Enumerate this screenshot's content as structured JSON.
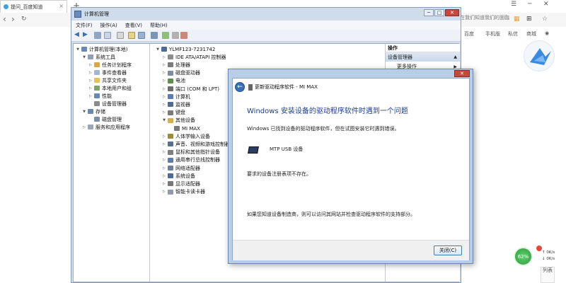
{
  "browser": {
    "tab_title": "提问_百度知道",
    "tab_close": "×",
    "new_tab": "+",
    "right_partial_text": "在我们知道我们的面臨",
    "links": [
      "百度",
      "手机版",
      "私信",
      "商城"
    ]
  },
  "device_manager": {
    "title": "计算机管理",
    "menu": [
      "文件(F)",
      "操作(A)",
      "查看(V)",
      "帮助(H)"
    ],
    "left_tree": [
      {
        "label": "计算机管理(本地)",
        "indent": 0,
        "expander": "▼"
      },
      {
        "label": "系统工具",
        "indent": 1,
        "expander": "▼"
      },
      {
        "label": "任务计划程序",
        "indent": 2,
        "expander": "▷"
      },
      {
        "label": "事件查看器",
        "indent": 2,
        "expander": "▷"
      },
      {
        "label": "共享文件夹",
        "indent": 2,
        "expander": "▷"
      },
      {
        "label": "本地用户和组",
        "indent": 2,
        "expander": "▷"
      },
      {
        "label": "性能",
        "indent": 2,
        "expander": "▷"
      },
      {
        "label": "设备管理器",
        "indent": 2,
        "expander": ""
      },
      {
        "label": "存储",
        "indent": 1,
        "expander": "▼"
      },
      {
        "label": "磁盘管理",
        "indent": 2,
        "expander": ""
      },
      {
        "label": "服务和应用程序",
        "indent": 1,
        "expander": "▷"
      }
    ],
    "device_tree": [
      {
        "label": "YLMF123-7231742",
        "indent": 0,
        "expander": "▼"
      },
      {
        "label": "IDE ATA/ATAPI 控制器",
        "indent": 1,
        "expander": "▷"
      },
      {
        "label": "处理器",
        "indent": 1,
        "expander": "▷"
      },
      {
        "label": "磁盘驱动器",
        "indent": 1,
        "expander": "▷"
      },
      {
        "label": "电池",
        "indent": 1,
        "expander": "▷"
      },
      {
        "label": "端口 (COM 和 LPT)",
        "indent": 1,
        "expander": "▷"
      },
      {
        "label": "计算机",
        "indent": 1,
        "expander": "▷"
      },
      {
        "label": "监视器",
        "indent": 1,
        "expander": "▷"
      },
      {
        "label": "键盘",
        "indent": 1,
        "expander": "▷"
      },
      {
        "label": "其他设备",
        "indent": 1,
        "expander": "▼"
      },
      {
        "label": "MI MAX",
        "indent": 2,
        "expander": ""
      },
      {
        "label": "人体学输入设备",
        "indent": 1,
        "expander": "▷"
      },
      {
        "label": "声音、视频和游戏控制器",
        "indent": 1,
        "expander": "▷"
      },
      {
        "label": "鼠标和其他指针设备",
        "indent": 1,
        "expander": "▷"
      },
      {
        "label": "通用串行总线控制器",
        "indent": 1,
        "expander": "▷"
      },
      {
        "label": "网络适配器",
        "indent": 1,
        "expander": "▷"
      },
      {
        "label": "系统设备",
        "indent": 1,
        "expander": "▷"
      },
      {
        "label": "显示适配器",
        "indent": 1,
        "expander": "▷"
      },
      {
        "label": "智能卡读卡器",
        "indent": 1,
        "expander": "▷"
      }
    ],
    "actions": {
      "header": "操作",
      "section": "设备管理器",
      "more": "更多操作",
      "section_arrow": "▲",
      "more_arrow": "▶"
    },
    "window_controls": {
      "minimize": "─",
      "maximize": "□",
      "close": "✕"
    }
  },
  "dialog": {
    "header": "更新驱动程序软件 - MI MAX",
    "title": "Windows 安装设备的驱动程序软件时遇到一个问题",
    "description": "Windows 已找到设备的驱动程序软件，但在试图安装它时遇到错误。",
    "device_name": "MTP USB 设备",
    "reason": "要求的设备注册表项不存在。",
    "help": "如果您知道设备制造商，则可以访问其网站并检查驱动程序软件的支持部分。",
    "close_button": "关闭(C)",
    "close_x": "✕",
    "back": "←"
  },
  "net_monitor": {
    "percent": "62%",
    "up": "0K/s",
    "down": "0K/s"
  },
  "side_tab": {
    "text": "列表"
  },
  "colors": {
    "dialog_title": "#1a3e8c",
    "window_frame": "#cfdcec",
    "close_red": "#c9463d",
    "net_green": "#3aa648"
  }
}
